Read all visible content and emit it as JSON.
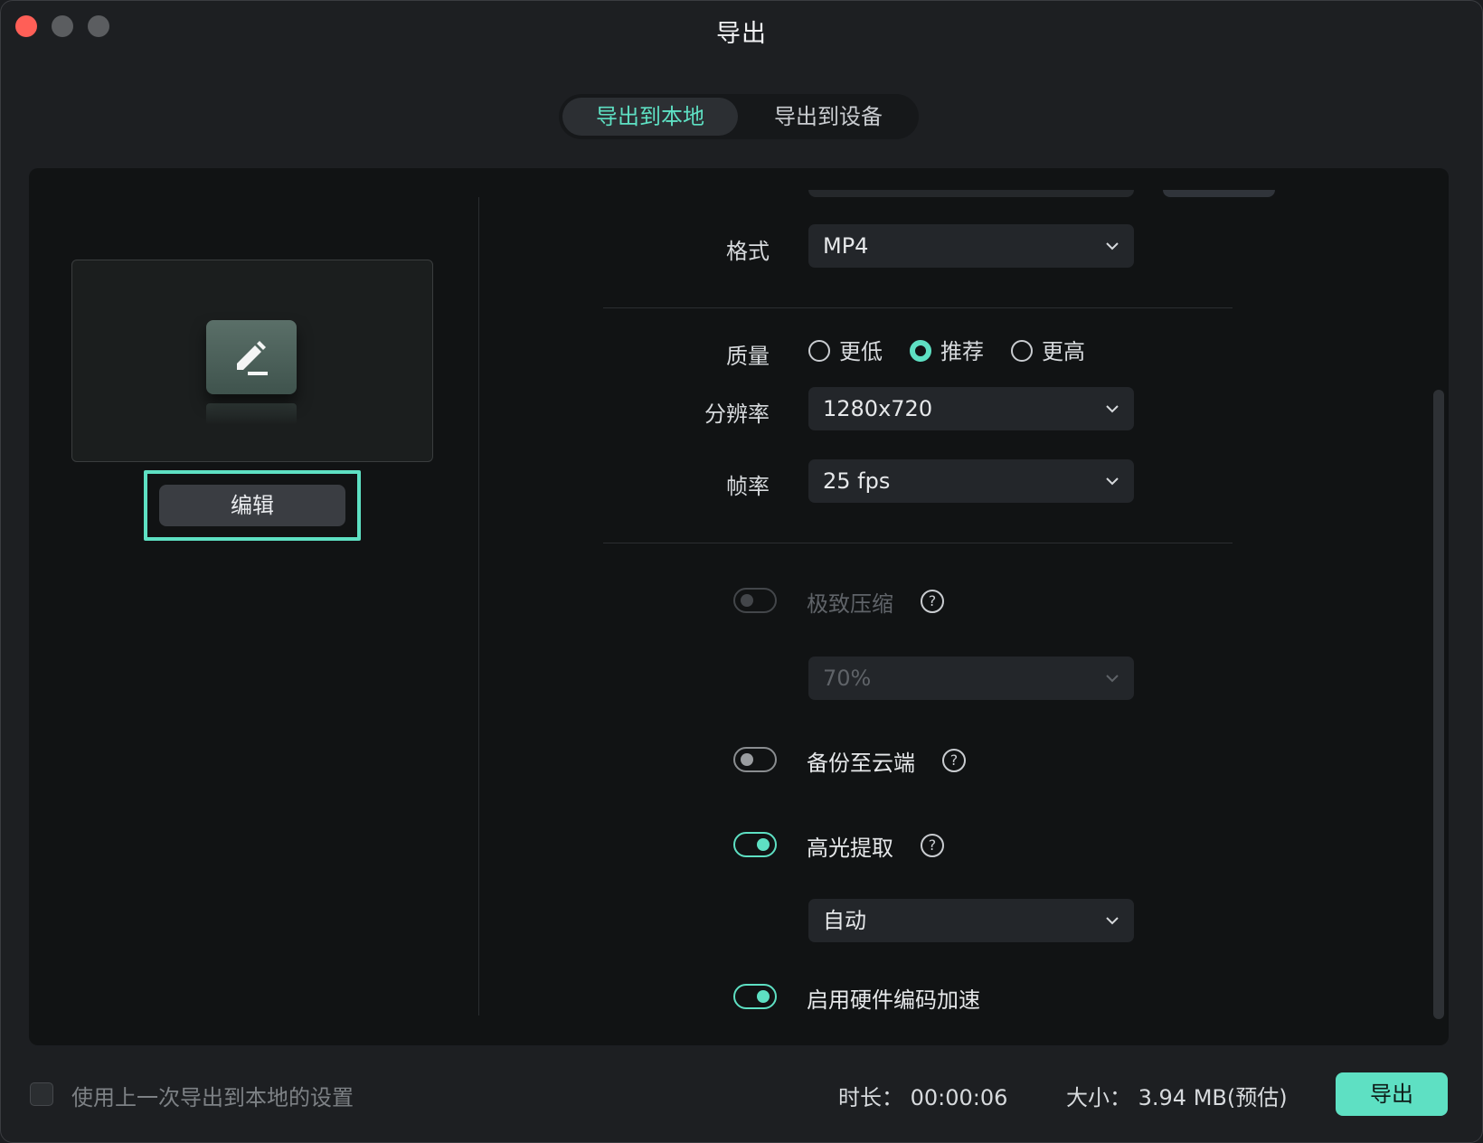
{
  "window": {
    "title": "导出"
  },
  "tabs": [
    {
      "label": "导出到本地",
      "active": true
    },
    {
      "label": "导出到设备",
      "active": false
    }
  ],
  "preview": {
    "icon": "edit-icon",
    "edit_label": "编辑"
  },
  "settings": {
    "format": {
      "label": "格式",
      "value": "MP4"
    },
    "quality": {
      "label": "质量",
      "options": [
        "更低",
        "推荐",
        "更高"
      ],
      "selected": "推荐"
    },
    "resolution": {
      "label": "分辨率",
      "value": "1280x720"
    },
    "framerate": {
      "label": "帧率",
      "value": "25 fps"
    },
    "compression": {
      "label": "极致压缩",
      "enabled": false,
      "value": "70%"
    },
    "cloud_backup": {
      "label": "备份至云端",
      "enabled": false
    },
    "highlight": {
      "label": "高光提取",
      "enabled": true,
      "value": "自动"
    },
    "hw_accel": {
      "label": "启用硬件编码加速",
      "enabled": true
    }
  },
  "footer": {
    "reuse_label": "使用上一次导出到本地的设置",
    "duration": "时长： 00:00:06",
    "size": "大小： 3.94 MB(预估)",
    "export_label": "导出"
  },
  "colors": {
    "accent": "#5ee0c3",
    "background": "#1d1f22",
    "panel": "#111314"
  }
}
